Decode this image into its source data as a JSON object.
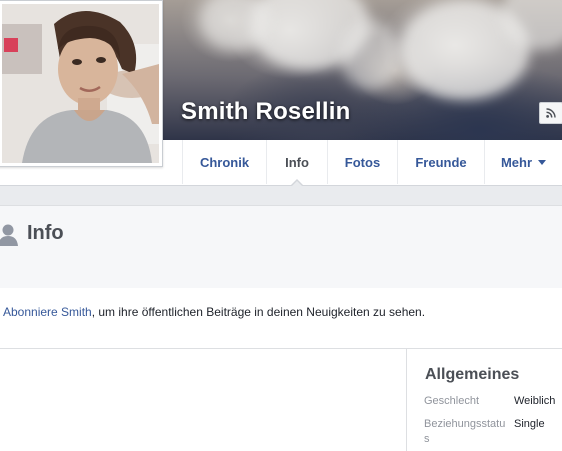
{
  "profile": {
    "name": "Smith Rosellin"
  },
  "nav": {
    "tabs": [
      {
        "label": "Chronik"
      },
      {
        "label": "Info"
      },
      {
        "label": "Fotos"
      },
      {
        "label": "Freunde"
      },
      {
        "label": "Mehr"
      }
    ],
    "active": "Info"
  },
  "info": {
    "title": "Info",
    "subscribe_link": "Abonniere Smith",
    "subscribe_rest": ", um ihre öffentlichen Beiträge in deinen Neuigkeiten zu sehen."
  },
  "general": {
    "title": "Allgemeines",
    "rows": [
      {
        "label": "Geschlecht",
        "value": "Weiblich"
      },
      {
        "label": "Beziehungsstatus",
        "value": "Single"
      }
    ]
  },
  "icons": {
    "rss": "rss-icon",
    "person": "person-icon",
    "dropdown": "chevron-down-icon"
  },
  "colors": {
    "link": "#365899",
    "page_bg": "#e9ebee"
  }
}
